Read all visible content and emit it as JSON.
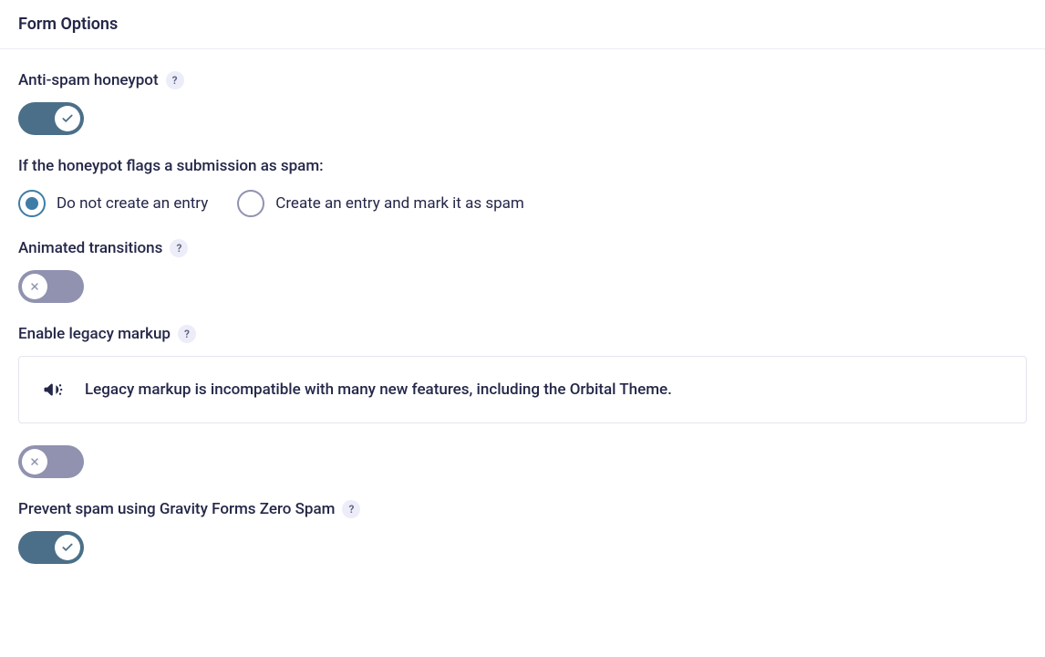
{
  "header": {
    "title": "Form Options"
  },
  "honeypot": {
    "label": "Anti-spam honeypot",
    "help": "?",
    "sub_label": "If the honeypot flags a submission as spam:",
    "radio1": "Do not create an entry",
    "radio2": "Create an entry and mark it as spam"
  },
  "animated": {
    "label": "Animated transitions",
    "help": "?"
  },
  "legacy": {
    "label": "Enable legacy markup",
    "help": "?",
    "notice": "Legacy markup is incompatible with many new features, including the Orbital Theme."
  },
  "zerospam": {
    "label": "Prevent spam using Gravity Forms Zero Spam",
    "help": "?"
  }
}
